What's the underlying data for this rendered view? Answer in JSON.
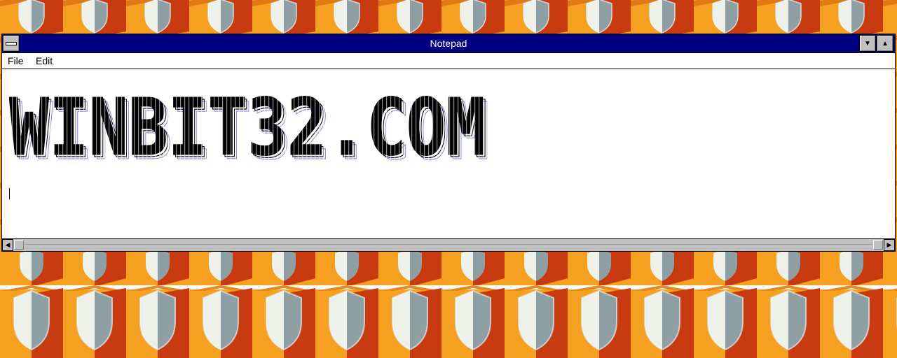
{
  "window": {
    "title": "Notepad"
  },
  "menubar": {
    "items": [
      "File",
      "Edit"
    ]
  },
  "document": {
    "content": "WINBIT32.COM"
  },
  "colors": {
    "titlebar": "#000080",
    "wallpaper_orange": "#f5a020",
    "wallpaper_red": "#c83a10",
    "wallpaper_shield_light": "#eef0ea",
    "wallpaper_shield_dark": "#8fa0a4"
  },
  "icons": [
    "system-menu-icon",
    "minimize-arrow-icon",
    "maximize-arrow-icon",
    "scroll-left-arrow-icon",
    "scroll-right-arrow-icon"
  ]
}
